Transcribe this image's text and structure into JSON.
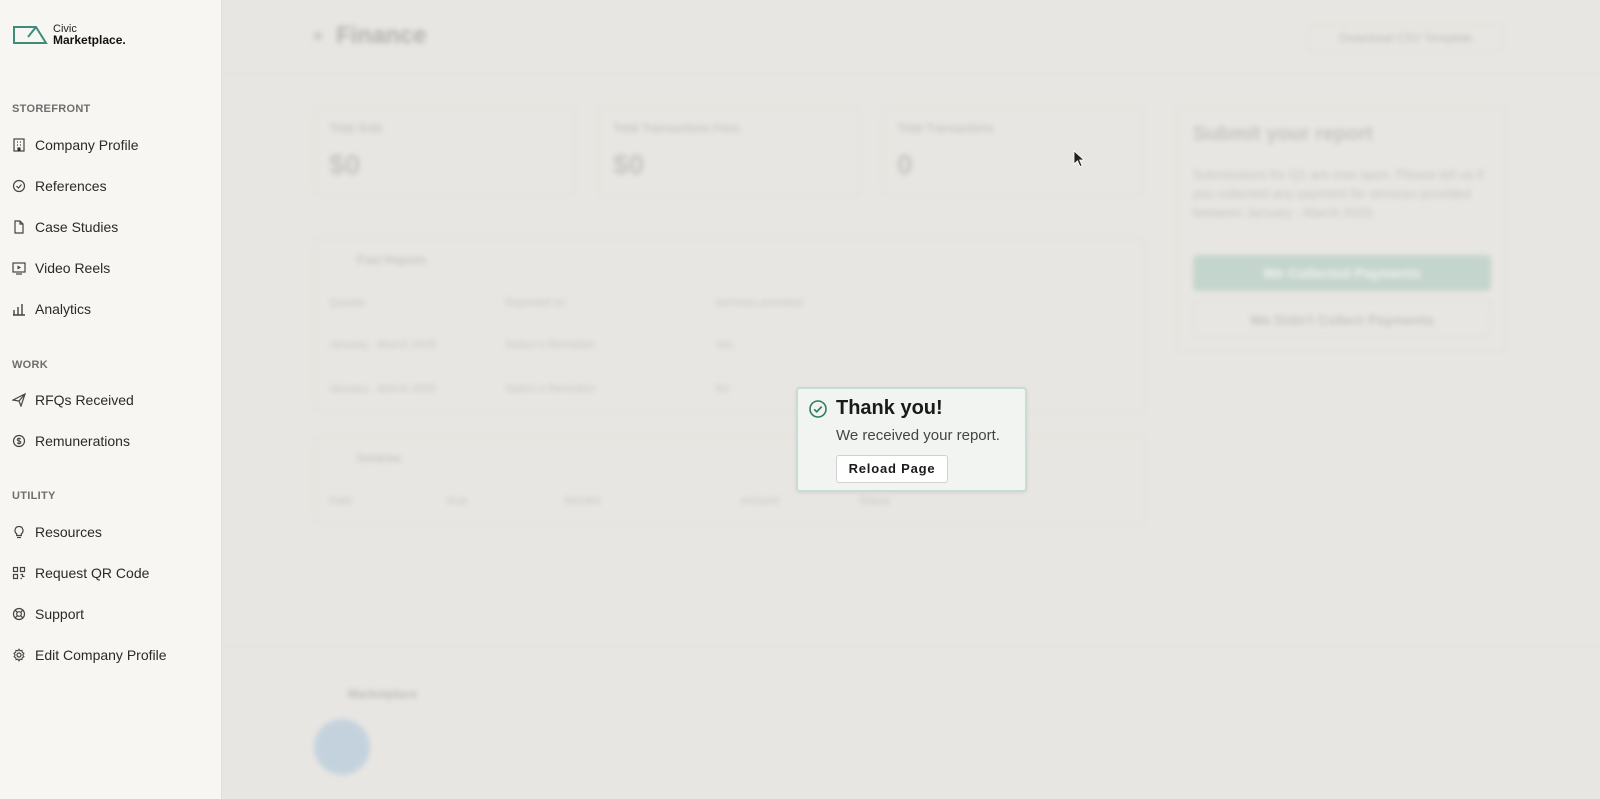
{
  "brand": {
    "name_top": "Civic",
    "name_bottom": "Marketplace",
    "mark": "."
  },
  "sidebar": {
    "sections": [
      {
        "label": "STOREFRONT",
        "items": [
          {
            "label": "Company Profile",
            "icon": "building-icon"
          },
          {
            "label": "References",
            "icon": "check-badge-icon"
          },
          {
            "label": "Case Studies",
            "icon": "document-icon"
          },
          {
            "label": "Video Reels",
            "icon": "video-icon"
          },
          {
            "label": "Analytics",
            "icon": "bar-chart-icon"
          }
        ]
      },
      {
        "label": "WORK",
        "items": [
          {
            "label": "RFQs Received",
            "icon": "send-icon"
          },
          {
            "label": "Remunerations",
            "icon": "dollar-icon"
          }
        ]
      },
      {
        "label": "UTILITY",
        "items": [
          {
            "label": "Resources",
            "icon": "lightbulb-icon"
          },
          {
            "label": "Request QR Code",
            "icon": "qr-code-icon"
          },
          {
            "label": "Support",
            "icon": "lifebuoy-icon"
          },
          {
            "label": "Edit Company Profile",
            "icon": "gear-icon"
          }
        ]
      }
    ]
  },
  "main": {
    "title": "Finance",
    "download_label": "Download CSV Template",
    "stats": [
      {
        "label": "Total Sold",
        "value": "$0"
      },
      {
        "label": "Total Transactions Fees",
        "value": "$0"
      },
      {
        "label": "Total Transactions",
        "value": "0"
      }
    ],
    "reports_panel": {
      "title": "Past Reports",
      "columns": [
        "Quarter",
        "Reported on",
        "Services provided"
      ],
      "rows": [
        [
          "January - March 2025",
          "Select a Remotion",
          "Yes"
        ],
        [
          "January - March 2025",
          "Select a Remotion",
          "No"
        ]
      ]
    },
    "invoices_panel": {
      "title": "Invoices",
      "columns": [
        "Date",
        "Due",
        "Months",
        "Amount",
        "Status"
      ]
    },
    "report_card": {
      "title": "Submit your report",
      "description": "Submissions for Q1 are now open. Please tell us if you collected any payment for services provided between January - March 2025.",
      "primary_label": "We Collected Payments",
      "secondary_label": "We Didn't Collect Payments"
    },
    "footer": {
      "brand": "Marketplace"
    }
  },
  "toast": {
    "title": "Thank you!",
    "message": "We received your report.",
    "button_label": "Reload Page",
    "accent": "#2f7d5c"
  },
  "colors": {
    "sidebar_bg": "#f7f6f3",
    "main_bg": "#e8e6e2",
    "toast_border": "#c9dbd5",
    "brand_green": "#3d8d7a"
  }
}
